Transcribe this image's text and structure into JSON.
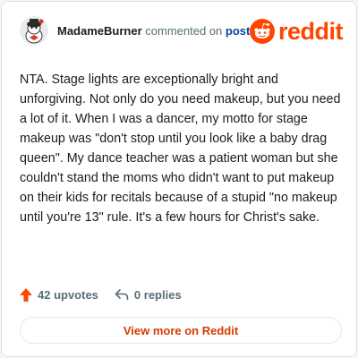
{
  "header": {
    "username": "MadameBurner",
    "action_text": "commented on",
    "post_link": "post",
    "logo_text": "reddit"
  },
  "comment": {
    "body": "NTA. Stage lights are exceptionally bright and unforgiving. Not only do you need makeup, but you need a lot of it. When I was a dancer, my motto for stage makeup was \"don't stop until you look like a baby drag queen\". My dance teacher was a patient woman but she couldn't stand the moms who didn't want to put makeup on their kids for recitals because of a stupid \"no makeup until you're 13\" rule. It's a few hours for Christ's sake."
  },
  "stats": {
    "upvotes": "42 upvotes",
    "replies": "0 replies"
  },
  "footer": {
    "view_more": "View more on Reddit"
  },
  "icons": {
    "upvote": "upvote-arrow-icon",
    "reply": "reply-arrow-icon",
    "logo": "reddit-snoo-icon",
    "avatar": "user-avatar"
  },
  "colors": {
    "brand": "#ff4500",
    "link": "#0a449b",
    "muted": "#576f76",
    "text": "#1c1c1c"
  }
}
